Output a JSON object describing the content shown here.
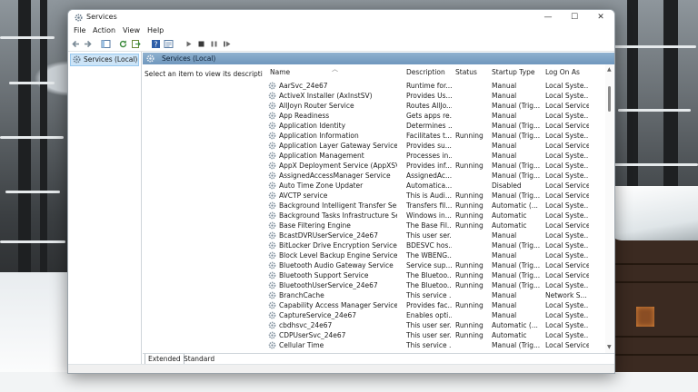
{
  "window": {
    "title": "Services",
    "controls": {
      "minimize": "—",
      "maximize": "☐",
      "close": "✕"
    }
  },
  "menu": [
    "File",
    "Action",
    "View",
    "Help"
  ],
  "toolbar": [
    "back-icon",
    "forward-icon",
    "show-hide-tree-icon",
    "refresh-icon",
    "export-list-icon",
    "help-icon",
    "properties-icon",
    "start-icon",
    "stop-icon",
    "pause-icon",
    "restart-icon"
  ],
  "tree": {
    "selected_label": "Services (Local)"
  },
  "pane_header": "Services (Local)",
  "description_prompt": "Select an item to view its description.",
  "columns": [
    "Name",
    "Description",
    "Status",
    "Startup Type",
    "Log On As"
  ],
  "services": [
    [
      "AarSvc_24e67",
      "Runtime for...",
      "",
      "Manual",
      "Local Syste..."
    ],
    [
      "ActiveX Installer (AxInstSV)",
      "Provides Us...",
      "",
      "Manual",
      "Local Syste..."
    ],
    [
      "AllJoyn Router Service",
      "Routes AllJo...",
      "",
      "Manual (Trig...",
      "Local Service"
    ],
    [
      "App Readiness",
      "Gets apps re...",
      "",
      "Manual",
      "Local Syste..."
    ],
    [
      "Application Identity",
      "Determines ...",
      "",
      "Manual (Trig...",
      "Local Service"
    ],
    [
      "Application Information",
      "Facilitates t...",
      "Running",
      "Manual (Trig...",
      "Local Syste..."
    ],
    [
      "Application Layer Gateway Service",
      "Provides su...",
      "",
      "Manual",
      "Local Service"
    ],
    [
      "Application Management",
      "Processes in...",
      "",
      "Manual",
      "Local Syste..."
    ],
    [
      "AppX Deployment Service (AppXSVC)",
      "Provides inf...",
      "Running",
      "Manual (Trig...",
      "Local Syste..."
    ],
    [
      "AssignedAccessManager Service",
      "AssignedAc...",
      "",
      "Manual (Trig...",
      "Local Syste..."
    ],
    [
      "Auto Time Zone Updater",
      "Automatica...",
      "",
      "Disabled",
      "Local Service"
    ],
    [
      "AVCTP service",
      "This is Audi...",
      "Running",
      "Manual (Trig...",
      "Local Service"
    ],
    [
      "Background Intelligent Transfer Service",
      "Transfers fil...",
      "Running",
      "Automatic (...",
      "Local Syste..."
    ],
    [
      "Background Tasks Infrastructure Service",
      "Windows in...",
      "Running",
      "Automatic",
      "Local Syste..."
    ],
    [
      "Base Filtering Engine",
      "The Base Fil...",
      "Running",
      "Automatic",
      "Local Service"
    ],
    [
      "BcastDVRUserService_24e67",
      "This user ser...",
      "",
      "Manual",
      "Local Syste..."
    ],
    [
      "BitLocker Drive Encryption Service",
      "BDESVC hos...",
      "",
      "Manual (Trig...",
      "Local Syste..."
    ],
    [
      "Block Level Backup Engine Service",
      "The WBENG...",
      "",
      "Manual",
      "Local Syste..."
    ],
    [
      "Bluetooth Audio Gateway Service",
      "Service sup...",
      "Running",
      "Manual (Trig...",
      "Local Service"
    ],
    [
      "Bluetooth Support Service",
      "The Bluetoo...",
      "Running",
      "Manual (Trig...",
      "Local Service"
    ],
    [
      "BluetoothUserService_24e67",
      "The Bluetoo...",
      "Running",
      "Manual (Trig...",
      "Local Syste..."
    ],
    [
      "BranchCache",
      "This service ...",
      "",
      "Manual",
      "Network S..."
    ],
    [
      "Capability Access Manager Service",
      "Provides fac...",
      "Running",
      "Manual",
      "Local Syste..."
    ],
    [
      "CaptureService_24e67",
      "Enables opti...",
      "",
      "Manual",
      "Local Syste..."
    ],
    [
      "cbdhsvc_24e67",
      "This user ser...",
      "Running",
      "Automatic (...",
      "Local Syste..."
    ],
    [
      "CDPUserSvc_24e67",
      "This user ser...",
      "Running",
      "Automatic",
      "Local Syste..."
    ],
    [
      "Cellular Time",
      "This service ...",
      "",
      "Manual (Trig...",
      "Local Service"
    ]
  ],
  "tabs": [
    "Extended",
    "Standard"
  ],
  "colors": {
    "header_blue": "#7aa0c4",
    "selection": "#cce4f7"
  }
}
